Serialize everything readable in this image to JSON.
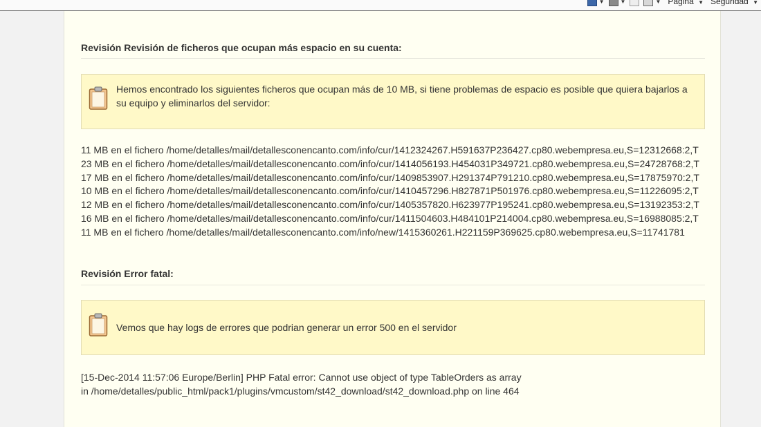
{
  "toolbar": {
    "page_label": "Página",
    "security_label": "Seguridad"
  },
  "section1": {
    "heading": "Revisión Revisión de ficheros que ocupan más espacio en su cuenta:",
    "notice": "Hemos encontrado los siguientes ficheros que ocupan más de 10 MB, si tiene problemas de espacio es posible que quiera bajarlos a su equipo y eliminarlos del servidor:",
    "files": [
      "11 MB en el fichero /home/detalles/mail/detallesconencanto.com/info/cur/1412324267.H591637P236427.cp80.webempresa.eu,S=12312668:2,T",
      "23 MB en el fichero /home/detalles/mail/detallesconencanto.com/info/cur/1414056193.H454031P349721.cp80.webempresa.eu,S=24728768:2,T",
      "17 MB en el fichero /home/detalles/mail/detallesconencanto.com/info/cur/1409853907.H291374P791210.cp80.webempresa.eu,S=17875970:2,T",
      "10 MB en el fichero /home/detalles/mail/detallesconencanto.com/info/cur/1410457296.H827871P501976.cp80.webempresa.eu,S=11226095:2,T",
      "12 MB en el fichero /home/detalles/mail/detallesconencanto.com/info/cur/1405357820.H623977P195241.cp80.webempresa.eu,S=13192353:2,T",
      "16 MB en el fichero /home/detalles/mail/detallesconencanto.com/info/cur/1411504603.H484101P214004.cp80.webempresa.eu,S=16988085:2,T",
      "11 MB en el fichero /home/detalles/mail/detallesconencanto.com/info/new/1415360261.H221159P369625.cp80.webempresa.eu,S=11741781"
    ]
  },
  "section2": {
    "heading": "Revisión Error fatal:",
    "notice": "Vemos que hay logs de errores que podrian generar un error 500 en el servidor",
    "log_lines": [
      "[15-Dec-2014 11:57:06 Europe/Berlin] PHP Fatal error: Cannot use object of type TableOrders as array",
      "in /home/detalles/public_html/pack1/plugins/vmcustom/st42_download/st42_download.php on line 464"
    ]
  },
  "colors": {
    "panel_bg": "#fffff2",
    "notice_bg": "#fff9c8",
    "notice_border": "#e2dcb4",
    "page_bg": "#f2f2f2"
  },
  "icons": {
    "notice": "clipboard-icon",
    "toolbar": [
      "home-icon",
      "rss-icon",
      "mail-icon",
      "print-icon"
    ]
  }
}
